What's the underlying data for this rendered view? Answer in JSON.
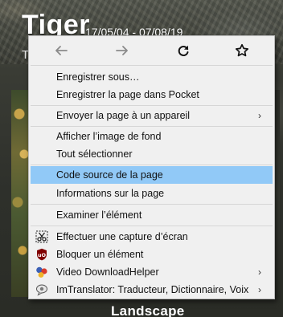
{
  "page": {
    "title": "Tiger",
    "dates": "17/05/04 - 07/08/19",
    "subtitle_fragment": "T",
    "bottom_heading": "Landscape"
  },
  "context_menu": {
    "nav": {
      "back_icon": "arrow-left-icon",
      "forward_icon": "arrow-right-icon",
      "reload_icon": "reload-icon",
      "bookmark_icon": "star-icon"
    },
    "items": [
      {
        "label": "Enregistrer sous…",
        "has_submenu": false
      },
      {
        "label": "Enregistrer la page dans Pocket",
        "has_submenu": false
      },
      {
        "label": "Envoyer la page à un appareil",
        "has_submenu": true
      },
      {
        "label": "Afficher l’image de fond",
        "has_submenu": false
      },
      {
        "label": "Tout sélectionner",
        "has_submenu": false
      },
      {
        "label": "Code source de la page",
        "has_submenu": false,
        "selected": true
      },
      {
        "label": "Informations sur la page",
        "has_submenu": false
      },
      {
        "label": "Examiner l’élément",
        "has_submenu": false
      },
      {
        "label": "Effectuer une capture d’écran",
        "has_submenu": false,
        "icon": "scissors-icon"
      },
      {
        "label": "Bloquer un élément",
        "has_submenu": false,
        "icon": "ublock-origin-icon"
      },
      {
        "label": "Video DownloadHelper",
        "has_submenu": true,
        "icon": "video-downloadhelper-icon"
      },
      {
        "label": "ImTranslator: Traducteur, Dictionnaire, Voix",
        "has_submenu": true,
        "icon": "imtranslator-icon"
      }
    ],
    "submenu_arrow": "›",
    "colors": {
      "menu_background": "#f0f0f0",
      "selection": "#91c9f7",
      "separator": "#d6d6d6",
      "ublock_red": "#800000"
    }
  }
}
